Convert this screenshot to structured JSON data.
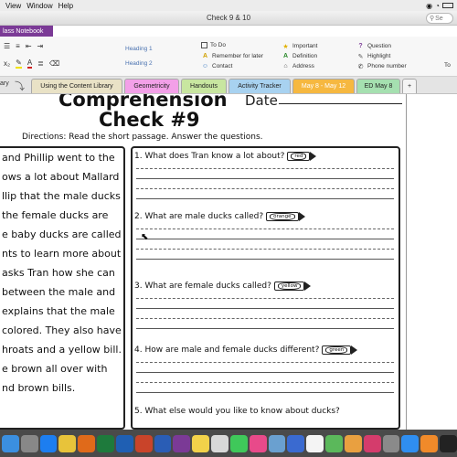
{
  "menubar": {
    "view": "View",
    "window": "Window",
    "help": "Help"
  },
  "window": {
    "title": "Check 9 & 10",
    "search_placeholder": "Se"
  },
  "app": {
    "notebook_label": "lass Notebook"
  },
  "ribbon": {
    "styles": {
      "heading1": "Heading 1",
      "heading2": "Heading 2"
    },
    "tags": {
      "todo": "To Do",
      "remember": "Remember for later",
      "contact": "Contact",
      "important": "Important",
      "definition": "Definition",
      "address": "Address",
      "question": "Question",
      "highlight": "Highlight",
      "phone": "Phone number",
      "todo_right": "To"
    }
  },
  "sections": {
    "library_label": "ary",
    "tabs": [
      {
        "label": "Using the Content Library",
        "color": "#e9e2c6"
      },
      {
        "label": "Geometricity",
        "color": "#f3a0e8"
      },
      {
        "label": "Handouts",
        "color": "#c8e6a0"
      },
      {
        "label": "Activity Tracker",
        "color": "#a8d2f0"
      },
      {
        "label": "May 8 - May 12",
        "color": "#f6b840"
      },
      {
        "label": "ED May 8",
        "color": "#a5e0b0"
      }
    ],
    "add_tab": "+"
  },
  "worksheet": {
    "title_line1": "Comprehension",
    "title_line2": "Check #9",
    "date_label": "Date",
    "directions": "Directions: Read the short passage. Answer the questions.",
    "passage_lines": [
      "and Phillip went to the",
      "ows a lot about Mallard",
      "llip that the male ducks",
      "the female ducks are",
      "e baby ducks are called",
      "nts to learn more about",
      "asks Tran how she can",
      "between the male and",
      "explains that the male",
      "colored. They also have",
      "hroats and a yellow bill.",
      "e brown all over with",
      "nd brown bills."
    ],
    "questions": [
      {
        "text": "1. What does Tran know a lot about?",
        "crayon": "red"
      },
      {
        "text": "2. What are male ducks called?",
        "crayon": "orange"
      },
      {
        "text": "3. What are female ducks called?",
        "crayon": "yellow"
      },
      {
        "text": "4. How are male and female ducks different?",
        "crayon": "green"
      },
      {
        "text": "5. What else would you like to know about ducks?",
        "crayon": ""
      }
    ]
  },
  "dock": {
    "icons": [
      "finder-icon",
      "launchpad-icon",
      "safari-icon",
      "chrome-icon",
      "firefox-icon",
      "excel-icon",
      "outlook-icon",
      "powerpoint-icon",
      "word-icon",
      "onenote-icon",
      "notes-icon",
      "photos-icon",
      "messages-icon",
      "itunes-icon",
      "preview-icon",
      "keynote-icon",
      "calendar-icon",
      "maps-icon",
      "photos2-icon",
      "music-icon",
      "settings-icon",
      "appstore-icon",
      "books-icon",
      "terminal-icon"
    ],
    "icon_colors": [
      "#3b8fe0",
      "#888",
      "#1d7ef0",
      "#e8c33a",
      "#e06a1a",
      "#1e7a3c",
      "#1f5fb3",
      "#c9442a",
      "#2a5db5",
      "#7b3a96",
      "#f2d24a",
      "#d8d8d8",
      "#3fc85a",
      "#e84a8a",
      "#6aa0d0",
      "#3a6ad0",
      "#f4f4f4",
      "#5bb85b",
      "#e9a040",
      "#d43c6c",
      "#8a8a8a",
      "#2f8ef0",
      "#f08a2a",
      "#222"
    ]
  }
}
